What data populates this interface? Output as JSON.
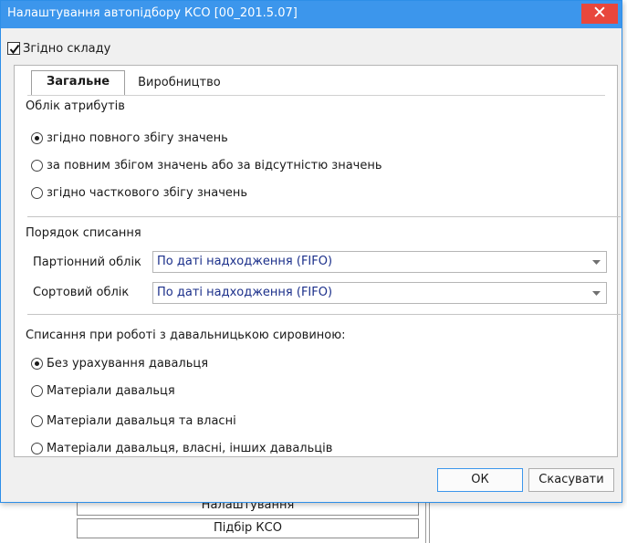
{
  "background": {
    "cell_1_label": "Налаштування",
    "cell_2_label": "Підбір КСО"
  },
  "dialog": {
    "title": "Налаштування автопідбору КСО [00_201.5.07]",
    "close_glyph": "✕",
    "checkbox_label": "Згідно складу",
    "checkbox_checked": true,
    "tabs": [
      {
        "label": "Загальне",
        "active": true
      },
      {
        "label": "Виробництво",
        "active": false
      }
    ],
    "attributes_section": {
      "title": "Облік атрибутів",
      "options": [
        {
          "label": "згідно повного збігу значень",
          "checked": true
        },
        {
          "label": "за повним збігом значень або за відсутністю значень",
          "checked": false
        },
        {
          "label": "згідно часткового збігу значень",
          "checked": false
        }
      ]
    },
    "writeoff_section": {
      "title": "Порядок списання",
      "batch_label": "Партіонний облік",
      "batch_value": "По даті надходження (FIFO)",
      "grade_label": "Сортовий облік",
      "grade_value": "По даті надходження (FIFO)"
    },
    "tolling_section": {
      "title": "Списання при роботі з давальницькою сировиною:",
      "options": [
        {
          "label": "Без урахування давальця",
          "checked": true
        },
        {
          "label": "Матеріали давальця",
          "checked": false
        },
        {
          "label": "Матеріали давальця та власні",
          "checked": false
        },
        {
          "label": "Матеріали давальця, власні, інших давальців",
          "checked": false
        }
      ]
    },
    "ok_label": "ОК",
    "cancel_label": "Скасувати"
  },
  "colors": {
    "titlebar": "#3c96ec",
    "close": "#e8473c",
    "select_text": "#1b2f8a"
  }
}
